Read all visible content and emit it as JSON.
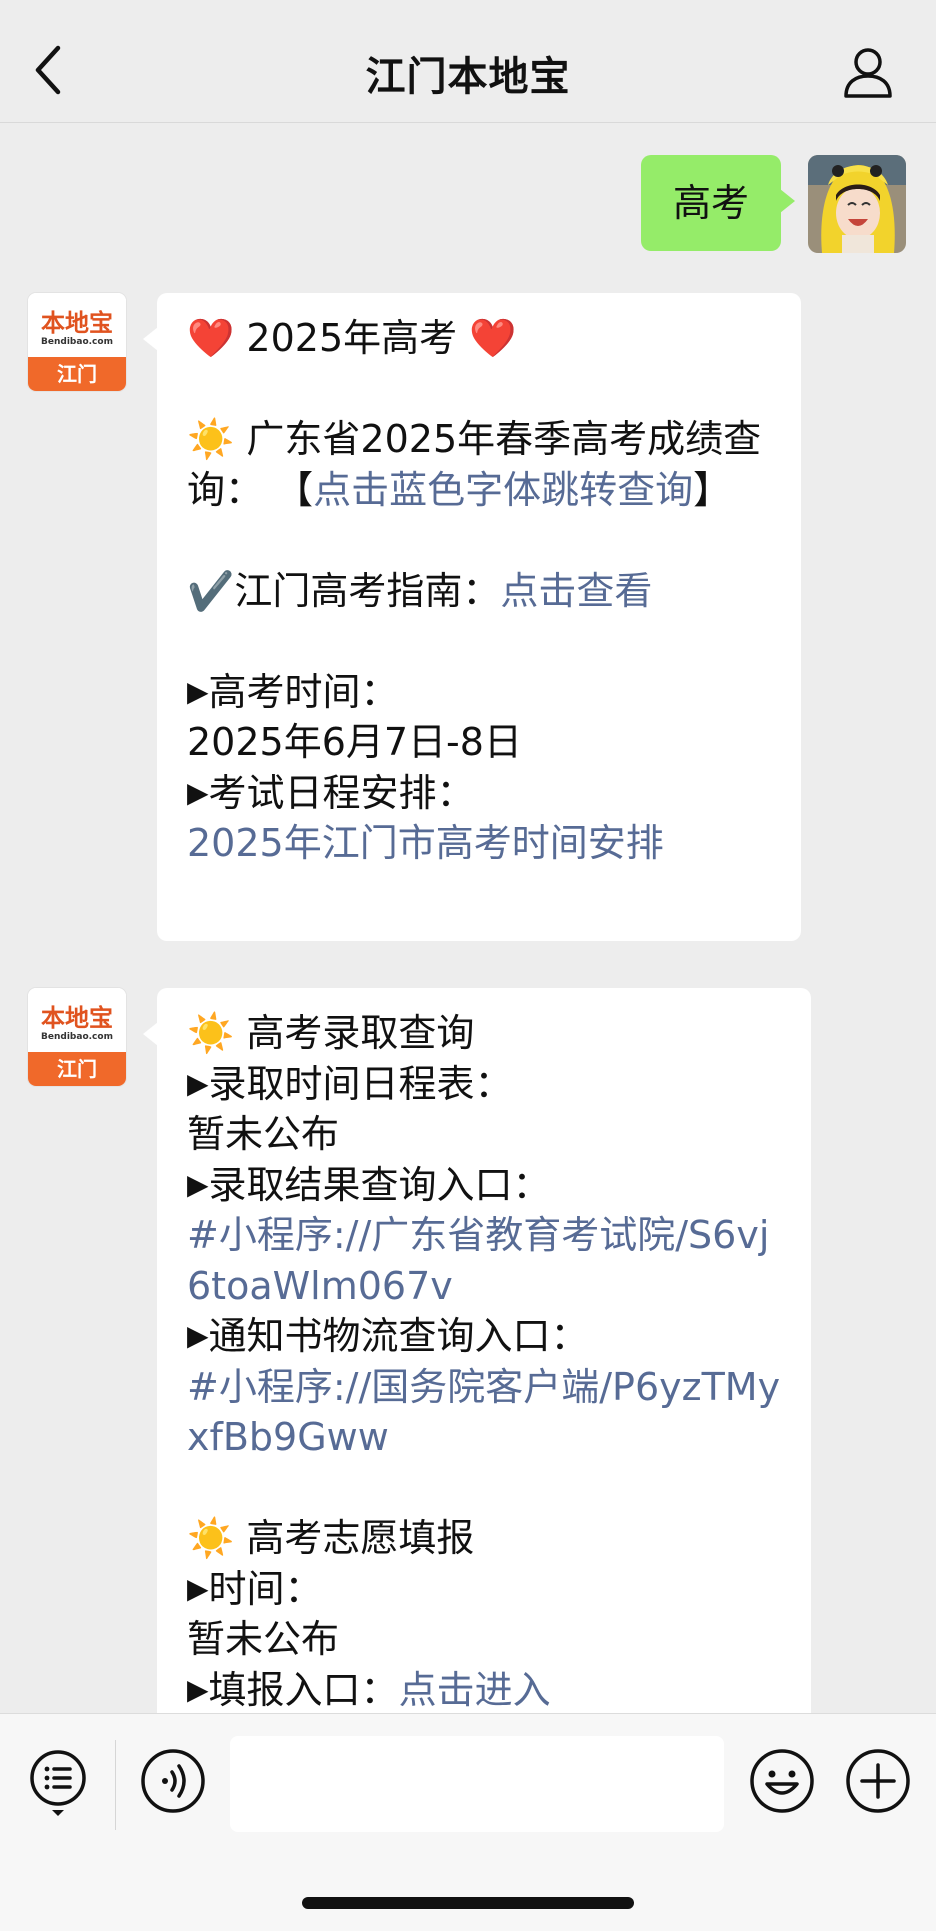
{
  "header": {
    "title": "江门本地宝",
    "back_icon": "chevron-left-icon",
    "profile_icon": "person-icon"
  },
  "outgoing": {
    "text": "高考"
  },
  "bot": {
    "avatar_brand": "本地宝",
    "avatar_site": "Bendibao.com",
    "avatar_city": "江门"
  },
  "message1": {
    "heart": "❤️",
    "title": "2025年高考",
    "sun": "☀️",
    "score_text": "广东省2025年春季高考成绩查询：",
    "score_bracket_open": "【",
    "score_link": "点击蓝色字体跳转查询",
    "score_bracket_close": "】",
    "check": "✔️",
    "guide_label": "江门高考指南：",
    "guide_link": "点击查看",
    "tri": "▶",
    "time_label": "高考时间：",
    "time_value": "2025年6月7日-8日",
    "schedule_label": "考试日程安排：",
    "schedule_link": "2025年江门市高考时间安排"
  },
  "message2": {
    "sun": "☀️",
    "tri": "▶",
    "admission_title": "高考录取查询",
    "admission_schedule_label": "录取时间日程表：",
    "admission_schedule_value": "暂未公布",
    "result_label": "录取结果查询入口：",
    "result_link": "#小程序://广东省教育考试院/S6vj6toaWlm067v",
    "notice_label": "通知书物流查询入口：",
    "notice_link": "#小程序://国务院客户端/P6yzTMyxfBb9Gww",
    "volunteer_title": "高考志愿填报",
    "volunteer_time_label": "时间：",
    "volunteer_time_value": "暂未公布",
    "volunteer_entry_label": "填报入口：",
    "volunteer_entry_link": "点击进入"
  },
  "inputbar": {
    "menu_icon": "menu-list-icon",
    "voice_icon": "voice-icon",
    "emoji_icon": "emoji-icon",
    "plus_icon": "plus-icon",
    "placeholder": ""
  }
}
